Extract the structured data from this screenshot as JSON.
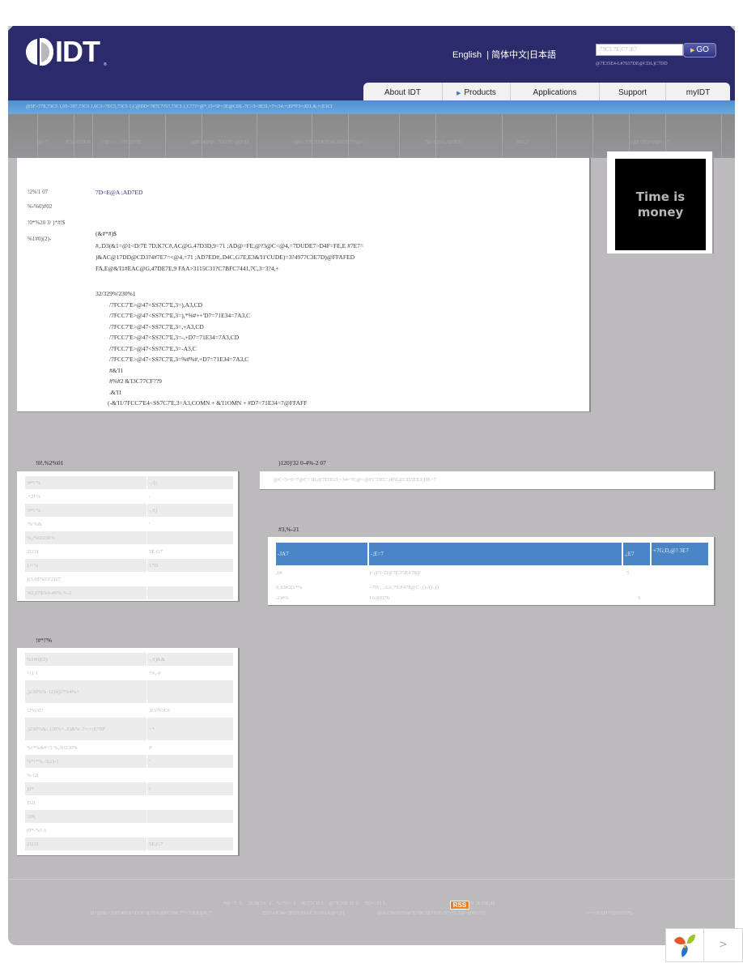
{
  "header": {
    "logo_text": "IDT",
    "logo_reg": "®",
    "languages": [
      "English",
      "简体中文",
      "日本語"
    ],
    "lang_separator": "|",
    "search": {
      "placeholder": ",73C5 7E;C7 ;E7",
      "go_label": "GO",
      "sub_link": "@7E35E4-L#7637DE@CDL)C7DD"
    },
    "nav": [
      {
        "label": "About IDT",
        "active": false
      },
      {
        "label": "Products",
        "active": true
      },
      {
        "label": "Applications",
        "active": false
      },
      {
        "label": "Support",
        "active": false
      },
      {
        "label": "myIDT",
        "active": false
      }
    ]
  },
  "breadcrumb_bar": "@5F>77E,73C5 1,05<397,73C5 1,0C3>7EC5,73C5 1,C@DD+787C7?57,73C5 1,C77?+@*,13=5F=3E@CDL-7C>3=3E3L+7=;34;=;EI*F3=;EI1,&;=;E3CI",
  "subnav": [
    "*@>7",
    "IC'@63'5ED",
    "<@5<>:>797@57D",
    "(@E74@@<.7CG7C<@5<D",
    "<@5<.?7E:7D:K7C41;AD7E/7%@C",
    "7D<E@A;AD7ED",
    "SS2.,7",
    "1@F>313=D@=;=7"
  ],
  "product_info": {
    "rows": [
      {
        "label": "!2%'1 07",
        "value": "7D<E@A ;AD7ED"
      },
      {
        "label": "%-%0)#02",
        "value": ""
      },
      {
        "label": "!0*%20 3/ )*#!$",
        "value": ""
      },
      {
        "label": "%1#0)(2)-",
        "value": "(&#*#)$"
      }
    ],
    "description": [
      "#,.D3(&1=@1<D/7E 7D,K7C#,AC@G,47D3D,9=71 ;AD@=FE,@?3@C<@4,=7DUDE7>D4F=FE,E #7E7=",
      ")&AC@17DD@CD3?4#7E7=<@4,=71 ;AD7ED#,.D4C,G7E,E3&'I1'CUDE)=3?4977C3E7D)@FFAFED",
      "FA,E@&'I1#EAC@G,47DE7E,9 FAA>3115C31?C7BFC7441,7C,3=3?4,+"
    ],
    "features_title": "32/329%'230%1",
    "features": [
      "/7FCC7'E>@47<SS7C7'E,3=),A3,CD",
      "/7FCC7'E>@47<SS7C7'E,3=),*%#++'D7=71E34=7A3,C",
      "/7FCC7'E>@47<SS7C7'E,3=,+A3,CD",
      "/7FCC7'E>@47<SS7C7'E,3=-,+D7=71E34=7A3,CD",
      "/7FCC7'E>@47<SS7C7'E,3=-A3,C",
      "/7FCC7'E>@47<SS7C7'E,3=%#%#,+D7=71E34=7A3,C",
      "#&'I1",
      "#%#2 &'I3C77CF??9",
      ".&'I1",
      "(-&'I1/7FCC7'E4<SS7C7'E,3=A3,COMN + &'I1OMN + #D7=71E34=7@FFAFF"
    ]
  },
  "promo": {
    "text_line1": "Time is",
    "text_line2": "money"
  },
  "attributes": {
    "title": "!0!,%2%01",
    "rows": [
      {
        "k": "!#*!'%",
        "v": "-,/()"
      },
      {
        "k": ".+2!'%",
        "v": "/"
      },
      {
        "k": "!#*!'%",
        "v": "-,/()"
      },
      {
        "k": "/%'%&",
        "v": "'"
      },
      {
        "k": "%,/%0!230%",
        "v": ""
      },
      {
        "k": "2!231",
        "v": "5E;G7"
      },
      {
        "k": "1/+%",
        "v": "17D"
      },
      {
        "k": ")!3,0$%03!2)27",
        "v": ""
      },
      {
        "k": "!#2,07$%0-#0%,%-2",
        "v": ""
      }
    ]
  },
  "documentation": {
    "title": ")120)'32 0-4%-2 07",
    "text": "'@C<5=9>7@C>3E,@7D3G3;=34=7C@<@FC'DEC';4FE@CD3EE3;DE>7"
  },
  "ordering": {
    "title": "#3,%-21",
    "headers": [
      "-JA7",
      "-;E=7",
      ",;E7",
      "+7G;D,@? 3E7"
    ],
    "rows": [
      {
        "type": ";I#",
        "title": ")<@5<D@7E3'5E478@",
        "size": "5",
        "rev": ""
      },
      {
        "type": "0,S3#2(1*%",
        "title": "/-7H , ;AA;79;F478@C-,()-/()-,()",
        "size": "",
        "rev": ""
      },
      {
        "type": ".2)#%",
        "title": "1A@D76",
        "size": "",
        "rev": "5"
      }
    ]
  },
  "quality": {
    "title": "!#*!'%",
    "rows": [
      {
        "k": "%1#0)(2)-",
        "v": "-,/()&&"
      },
      {
        "k": "+!1 1",
        "v": "!%,-#"
      },
      {
        "k": ",)230%%-12)4)27%4%+",
        "v": ""
      },
      {
        "k": "!2%'/07",
        "v": ",E3763C6"
      },
      {
        "k": ",)230%&/,130%+..0)&% .?=;=;E76P",
        "v": "+*"
      },
      {
        "k": "%!*%&#+5 %,/0!230%",
        "v": "P"
      },
      {
        "k": "%*!*%,-5(2)-1",
        "v": "'"
      },
      {
        "k": "%-!2(",
        "v": ""
      },
      {
        "k": ")0*",
        "v": "!"
      },
      {
        "k": ")52(",
        "v": ""
      },
      {
        "k": "!2#(",
        "v": ""
      },
      {
        "k": "(0*-%1 1",
        "v": ""
      },
      {
        "k": "2!231",
        "v": "5E;G7"
      }
    ]
  },
  "footer": {
    "links": [
      "*@>7",
      ",;E7&3A",
      "%793=",
      "3C77CD",
      "@7E35E D",
      "*F3=;EI"
    ],
    "link_separator": "1.",
    "rss_label": "RSS",
    "rss_text": "0 3E;DE;D",
    "line2_left": ".D7@8E<;D074D;E7D;97 8;7D1@FC39C77>7?EE@E.7",
    "line2_mid": "3557AE34=7FD73%AC;G351A@=;51",
    "line2_mid2": "@A;C9<EO%#7E79C3E767G;57-75 ?@=@91?75",
    "line2_right": "==+;9 ED+7D7CG76"
  },
  "widget": {
    "next_label": ">"
  }
}
